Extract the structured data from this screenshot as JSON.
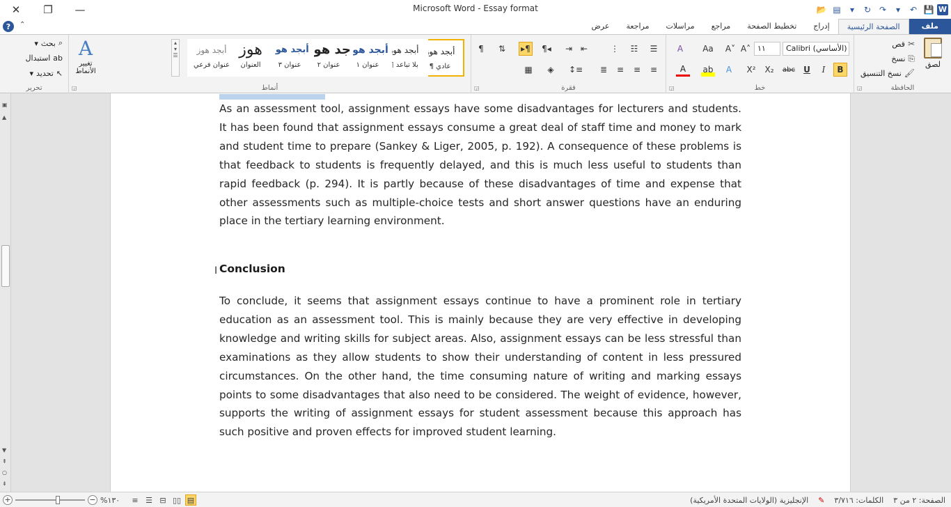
{
  "window": {
    "app_title": "Microsoft Word",
    "separator": " - ",
    "doc_title": "Essay format"
  },
  "ribbon_tabs": [
    {
      "label": "ملف",
      "kind": "file"
    },
    {
      "label": "الصفحة الرئيسية",
      "kind": "active"
    },
    {
      "label": "إدراج",
      "kind": ""
    },
    {
      "label": "تخطيط الصفحة",
      "kind": ""
    },
    {
      "label": "مراجع",
      "kind": ""
    },
    {
      "label": "مراسلات",
      "kind": ""
    },
    {
      "label": "مراجعة",
      "kind": ""
    },
    {
      "label": "عرض",
      "kind": ""
    }
  ],
  "clipboard": {
    "group_label": "الحافظة",
    "paste": "لصق",
    "cut": "قص",
    "copy": "نسخ",
    "format_painter": "نسخ التنسيق"
  },
  "font": {
    "group_label": "خط",
    "font_name": "Calibri (الأساسي)",
    "font_size": "١١",
    "bold": "B",
    "italic": "I",
    "underline": "U",
    "strikethrough": "abc",
    "subscript": "X₂",
    "superscript": "X²",
    "grow": "A˄",
    "shrink": "A˅",
    "change_case": "Aa",
    "clear_format": "A",
    "text_effects": "A",
    "highlight": "ab",
    "font_color": "A"
  },
  "paragraph": {
    "group_label": "فقرة"
  },
  "styles": {
    "group_label": "أنماط",
    "items": [
      {
        "sample": "أبجد هوز",
        "name": "¶ عادي",
        "selected": true
      },
      {
        "sample": "أبجد هوز",
        "name": "¶ بلا تباعد",
        "selected": false
      },
      {
        "sample": "أبجد هوز",
        "name": "عنوان ١",
        "selected": false
      },
      {
        "sample": "جد هوز",
        "name": "عنوان ٢",
        "selected": false
      },
      {
        "sample": "أبجد هوز",
        "name": "عنوان ٣",
        "selected": false
      },
      {
        "sample": "هوز",
        "name": "العنوان",
        "selected": false
      },
      {
        "sample": "أبجد هوز",
        "name": "عنوان فرعي",
        "selected": false
      }
    ],
    "change_styles": "تغيير الأنماط"
  },
  "editing": {
    "group_label": "تحرير",
    "find": "بحث",
    "replace": "استبدال",
    "select": "تحديد"
  },
  "document": {
    "para1": "As an assessment tool, assignment essays have some disadvantages for lecturers and students. It has been found that assignment essays consume a great deal of staff time and money to mark and student time to prepare (Sankey & Liger, 2005, p. 192). A consequence of these problems is that feedback to students is frequently delayed, and this is much less useful to students than rapid feedback (p. 294). It is partly because of these disadvantages of time and expense that other assessments such as multiple-choice tests and short answer questions have an enduring place in the tertiary learning environment.",
    "heading": "Conclusion",
    "para2": "To conclude, it seems that assignment essays continue to have a prominent role in tertiary education as an assessment tool. This is mainly because they are very effective in developing knowledge and writing skills for subject areas. Also, assignment essays can be less stressful than examinations as they allow students to show their understanding of content in less pressured circumstances. On the other hand, the time consuming nature of writing and marking essays points to some disadvantages that also need to be considered. The weight of evidence, however, supports the writing of assignment essays for student assessment because this approach has such positive and proven effects for improved student learning."
  },
  "status": {
    "page": "الصفحة: ٢ من ٣",
    "words": "الكلمات: ٣/٧١٦",
    "language": "الإنجليزية (الولايات المتحدة الأمريكية)",
    "zoom": "%١٣٠"
  }
}
